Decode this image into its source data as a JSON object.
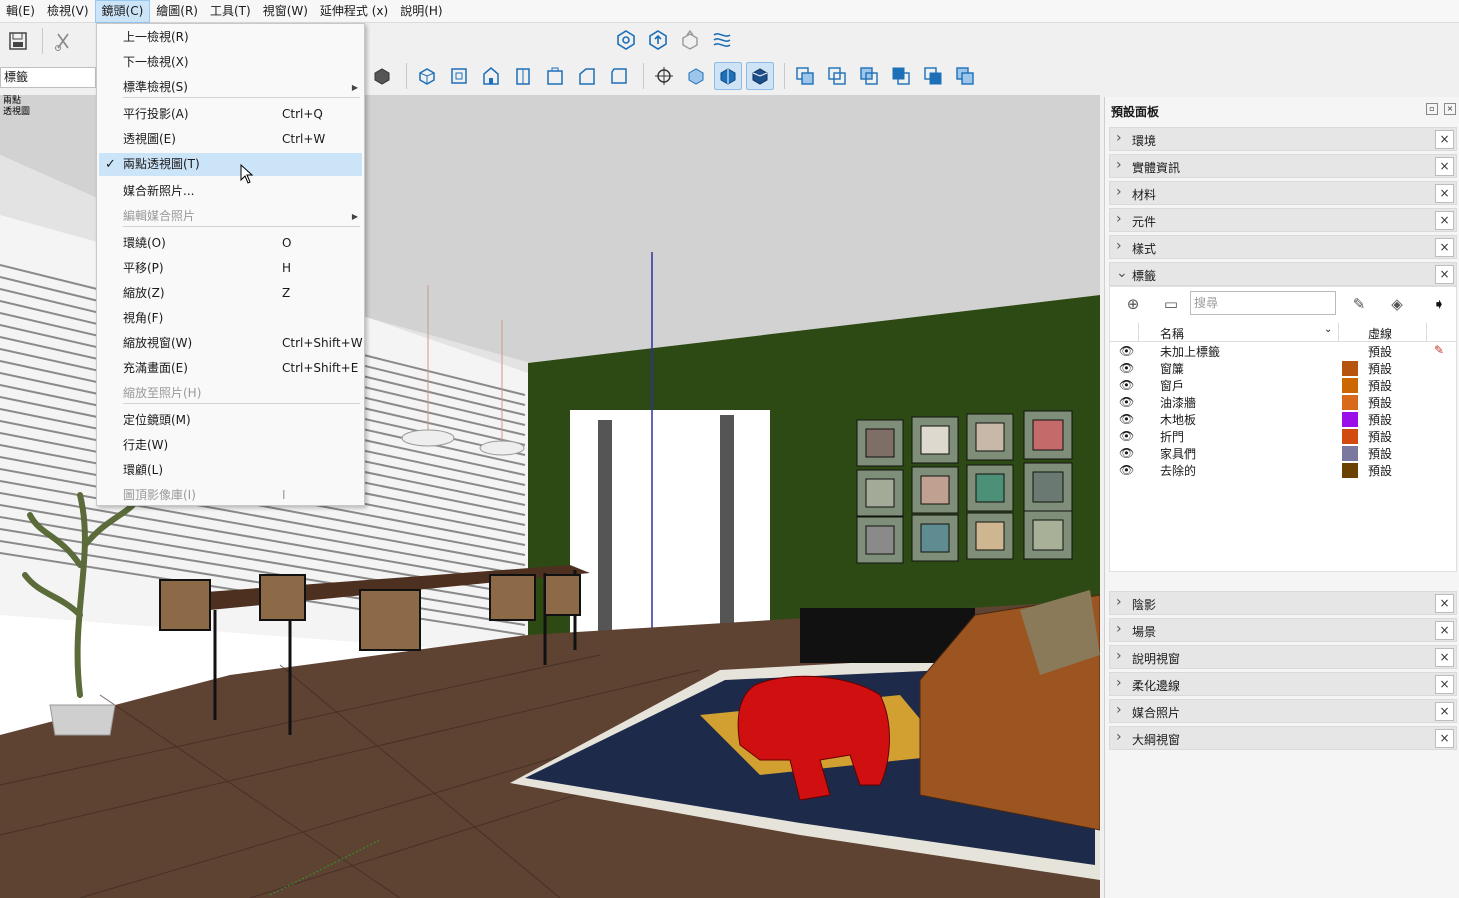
{
  "menubar": {
    "items": [
      "輯(E)",
      "檢視(V)",
      "鏡頭(C)",
      "繪圖(R)",
      "工具(T)",
      "視窗(W)",
      "延伸程式 (x)",
      "說明(H)"
    ],
    "active_index": 2
  },
  "tag_box": {
    "value": "標籤"
  },
  "scene_label": {
    "line1": "兩點",
    "line2": "透視圖"
  },
  "camera_menu": {
    "items": [
      {
        "label": "上一檢視(R)",
        "shortcut": "",
        "state": "normal"
      },
      {
        "label": "下一檢視(X)",
        "shortcut": "",
        "state": "normal"
      },
      {
        "label": "標準檢視(S)",
        "shortcut": "",
        "state": "submenu"
      },
      {
        "label": "平行投影(A)",
        "shortcut": "Ctrl+Q",
        "state": "normal"
      },
      {
        "label": "透視圖(E)",
        "shortcut": "Ctrl+W",
        "state": "normal"
      },
      {
        "label": "兩點透視圖(T)",
        "shortcut": "",
        "state": "checked-highlight"
      },
      {
        "label": "媒合新照片...",
        "shortcut": "",
        "state": "normal"
      },
      {
        "label": "編輯媒合照片",
        "shortcut": "",
        "state": "disabled-submenu"
      },
      {
        "label": "環繞(O)",
        "shortcut": "O",
        "state": "normal"
      },
      {
        "label": "平移(P)",
        "shortcut": "H",
        "state": "normal"
      },
      {
        "label": "縮放(Z)",
        "shortcut": "Z",
        "state": "normal"
      },
      {
        "label": "視角(F)",
        "shortcut": "",
        "state": "normal"
      },
      {
        "label": "縮放視窗(W)",
        "shortcut": "Ctrl+Shift+W",
        "state": "normal"
      },
      {
        "label": "充滿畫面(E)",
        "shortcut": "Ctrl+Shift+E",
        "state": "normal"
      },
      {
        "label": "縮放至照片(H)",
        "shortcut": "",
        "state": "disabled"
      },
      {
        "label": "定位鏡頭(M)",
        "shortcut": "",
        "state": "normal"
      },
      {
        "label": "行走(W)",
        "shortcut": "",
        "state": "normal"
      },
      {
        "label": "環顧(L)",
        "shortcut": "",
        "state": "normal"
      },
      {
        "label": "圖頂影像庫(I)",
        "shortcut": "I",
        "state": "disabled"
      }
    ],
    "checkmark": "✓"
  },
  "panel": {
    "title": "預設面板",
    "trays_top": [
      "環境",
      "實體資訊",
      "材料",
      "元件",
      "樣式",
      "標籤"
    ],
    "trays_bottom": [
      "陰影",
      "場景",
      "說明視窗",
      "柔化邊線",
      "媒合照片",
      "大綱視窗"
    ],
    "tags": {
      "search_placeholder": "搜尋",
      "col_name": "名稱",
      "col_dash": "虛線",
      "rows": [
        {
          "name": "未加上標籤",
          "color": "",
          "dash": "預設",
          "active": true
        },
        {
          "name": "窗簾",
          "color": "#b5530f",
          "dash": "預設",
          "active": false
        },
        {
          "name": "窗戶",
          "color": "#cc6600",
          "dash": "預設",
          "active": false
        },
        {
          "name": "油漆牆",
          "color": "#d86a1a",
          "dash": "預設",
          "active": false
        },
        {
          "name": "木地板",
          "color": "#9a10e8",
          "dash": "預設",
          "active": false
        },
        {
          "name": "折門",
          "color": "#d14a10",
          "dash": "預設",
          "active": false
        },
        {
          "name": "家具們",
          "color": "#7a789e",
          "dash": "預設",
          "active": false
        },
        {
          "name": "去除的",
          "color": "#6b4200",
          "dash": "預設",
          "active": false
        }
      ]
    }
  },
  "colors": {
    "accent": "#cce4f7",
    "wall_green": "#2e4a14",
    "floor": "#5e4232",
    "chair_red": "#d01010",
    "sofa": "#9c5420"
  }
}
